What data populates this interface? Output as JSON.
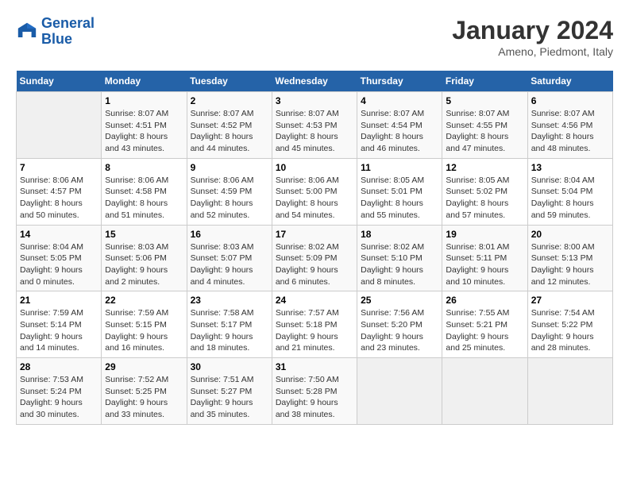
{
  "logo": {
    "line1": "General",
    "line2": "Blue"
  },
  "title": "January 2024",
  "subtitle": "Ameno, Piedmont, Italy",
  "days_header": [
    "Sunday",
    "Monday",
    "Tuesday",
    "Wednesday",
    "Thursday",
    "Friday",
    "Saturday"
  ],
  "weeks": [
    [
      {
        "day": "",
        "details": ""
      },
      {
        "day": "1",
        "details": "Sunrise: 8:07 AM\nSunset: 4:51 PM\nDaylight: 8 hours\nand 43 minutes."
      },
      {
        "day": "2",
        "details": "Sunrise: 8:07 AM\nSunset: 4:52 PM\nDaylight: 8 hours\nand 44 minutes."
      },
      {
        "day": "3",
        "details": "Sunrise: 8:07 AM\nSunset: 4:53 PM\nDaylight: 8 hours\nand 45 minutes."
      },
      {
        "day": "4",
        "details": "Sunrise: 8:07 AM\nSunset: 4:54 PM\nDaylight: 8 hours\nand 46 minutes."
      },
      {
        "day": "5",
        "details": "Sunrise: 8:07 AM\nSunset: 4:55 PM\nDaylight: 8 hours\nand 47 minutes."
      },
      {
        "day": "6",
        "details": "Sunrise: 8:07 AM\nSunset: 4:56 PM\nDaylight: 8 hours\nand 48 minutes."
      }
    ],
    [
      {
        "day": "7",
        "details": "Sunrise: 8:06 AM\nSunset: 4:57 PM\nDaylight: 8 hours\nand 50 minutes."
      },
      {
        "day": "8",
        "details": "Sunrise: 8:06 AM\nSunset: 4:58 PM\nDaylight: 8 hours\nand 51 minutes."
      },
      {
        "day": "9",
        "details": "Sunrise: 8:06 AM\nSunset: 4:59 PM\nDaylight: 8 hours\nand 52 minutes."
      },
      {
        "day": "10",
        "details": "Sunrise: 8:06 AM\nSunset: 5:00 PM\nDaylight: 8 hours\nand 54 minutes."
      },
      {
        "day": "11",
        "details": "Sunrise: 8:05 AM\nSunset: 5:01 PM\nDaylight: 8 hours\nand 55 minutes."
      },
      {
        "day": "12",
        "details": "Sunrise: 8:05 AM\nSunset: 5:02 PM\nDaylight: 8 hours\nand 57 minutes."
      },
      {
        "day": "13",
        "details": "Sunrise: 8:04 AM\nSunset: 5:04 PM\nDaylight: 8 hours\nand 59 minutes."
      }
    ],
    [
      {
        "day": "14",
        "details": "Sunrise: 8:04 AM\nSunset: 5:05 PM\nDaylight: 9 hours\nand 0 minutes."
      },
      {
        "day": "15",
        "details": "Sunrise: 8:03 AM\nSunset: 5:06 PM\nDaylight: 9 hours\nand 2 minutes."
      },
      {
        "day": "16",
        "details": "Sunrise: 8:03 AM\nSunset: 5:07 PM\nDaylight: 9 hours\nand 4 minutes."
      },
      {
        "day": "17",
        "details": "Sunrise: 8:02 AM\nSunset: 5:09 PM\nDaylight: 9 hours\nand 6 minutes."
      },
      {
        "day": "18",
        "details": "Sunrise: 8:02 AM\nSunset: 5:10 PM\nDaylight: 9 hours\nand 8 minutes."
      },
      {
        "day": "19",
        "details": "Sunrise: 8:01 AM\nSunset: 5:11 PM\nDaylight: 9 hours\nand 10 minutes."
      },
      {
        "day": "20",
        "details": "Sunrise: 8:00 AM\nSunset: 5:13 PM\nDaylight: 9 hours\nand 12 minutes."
      }
    ],
    [
      {
        "day": "21",
        "details": "Sunrise: 7:59 AM\nSunset: 5:14 PM\nDaylight: 9 hours\nand 14 minutes."
      },
      {
        "day": "22",
        "details": "Sunrise: 7:59 AM\nSunset: 5:15 PM\nDaylight: 9 hours\nand 16 minutes."
      },
      {
        "day": "23",
        "details": "Sunrise: 7:58 AM\nSunset: 5:17 PM\nDaylight: 9 hours\nand 18 minutes."
      },
      {
        "day": "24",
        "details": "Sunrise: 7:57 AM\nSunset: 5:18 PM\nDaylight: 9 hours\nand 21 minutes."
      },
      {
        "day": "25",
        "details": "Sunrise: 7:56 AM\nSunset: 5:20 PM\nDaylight: 9 hours\nand 23 minutes."
      },
      {
        "day": "26",
        "details": "Sunrise: 7:55 AM\nSunset: 5:21 PM\nDaylight: 9 hours\nand 25 minutes."
      },
      {
        "day": "27",
        "details": "Sunrise: 7:54 AM\nSunset: 5:22 PM\nDaylight: 9 hours\nand 28 minutes."
      }
    ],
    [
      {
        "day": "28",
        "details": "Sunrise: 7:53 AM\nSunset: 5:24 PM\nDaylight: 9 hours\nand 30 minutes."
      },
      {
        "day": "29",
        "details": "Sunrise: 7:52 AM\nSunset: 5:25 PM\nDaylight: 9 hours\nand 33 minutes."
      },
      {
        "day": "30",
        "details": "Sunrise: 7:51 AM\nSunset: 5:27 PM\nDaylight: 9 hours\nand 35 minutes."
      },
      {
        "day": "31",
        "details": "Sunrise: 7:50 AM\nSunset: 5:28 PM\nDaylight: 9 hours\nand 38 minutes."
      },
      {
        "day": "",
        "details": ""
      },
      {
        "day": "",
        "details": ""
      },
      {
        "day": "",
        "details": ""
      }
    ]
  ]
}
